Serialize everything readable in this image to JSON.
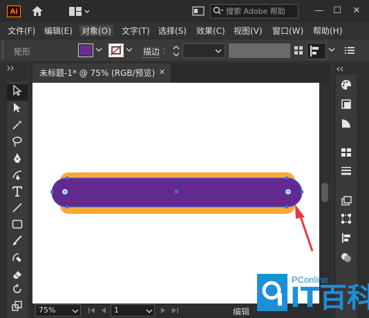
{
  "app": {
    "logo": "Ai"
  },
  "titlebar": {
    "search_placeholder": "搜索 Adobe 帮助",
    "minimize": "—",
    "maximize": "☐",
    "close": "✕"
  },
  "menu": [
    {
      "label": "文件(F)"
    },
    {
      "label": "编辑(E)"
    },
    {
      "label": "对象(O)",
      "active": true
    },
    {
      "label": "文字(T)"
    },
    {
      "label": "选择(S)"
    },
    {
      "label": "效果(C)"
    },
    {
      "label": "视图(V)"
    },
    {
      "label": "窗口(W)"
    },
    {
      "label": "帮助(H)"
    }
  ],
  "controlbar": {
    "object_type": "矩形",
    "stroke_label": "描边",
    "stroke_colon": ":",
    "fill_color": "#6a2d93",
    "stroke_value": ""
  },
  "document": {
    "tab_title": "未标题-1* @ 75% (RGB/预览)",
    "close": "✕"
  },
  "artwork": {
    "back_color": "#f5aa3c",
    "front_color": "#622a8f",
    "selection_color": "#3f6de0",
    "arrow_color": "#e83a3a"
  },
  "status": {
    "zoom": "75%",
    "page": "1",
    "mode": "编辑"
  },
  "watermark": {
    "brand": "PConline",
    "text": "IT百科",
    "accent": "#1c8fd9"
  }
}
